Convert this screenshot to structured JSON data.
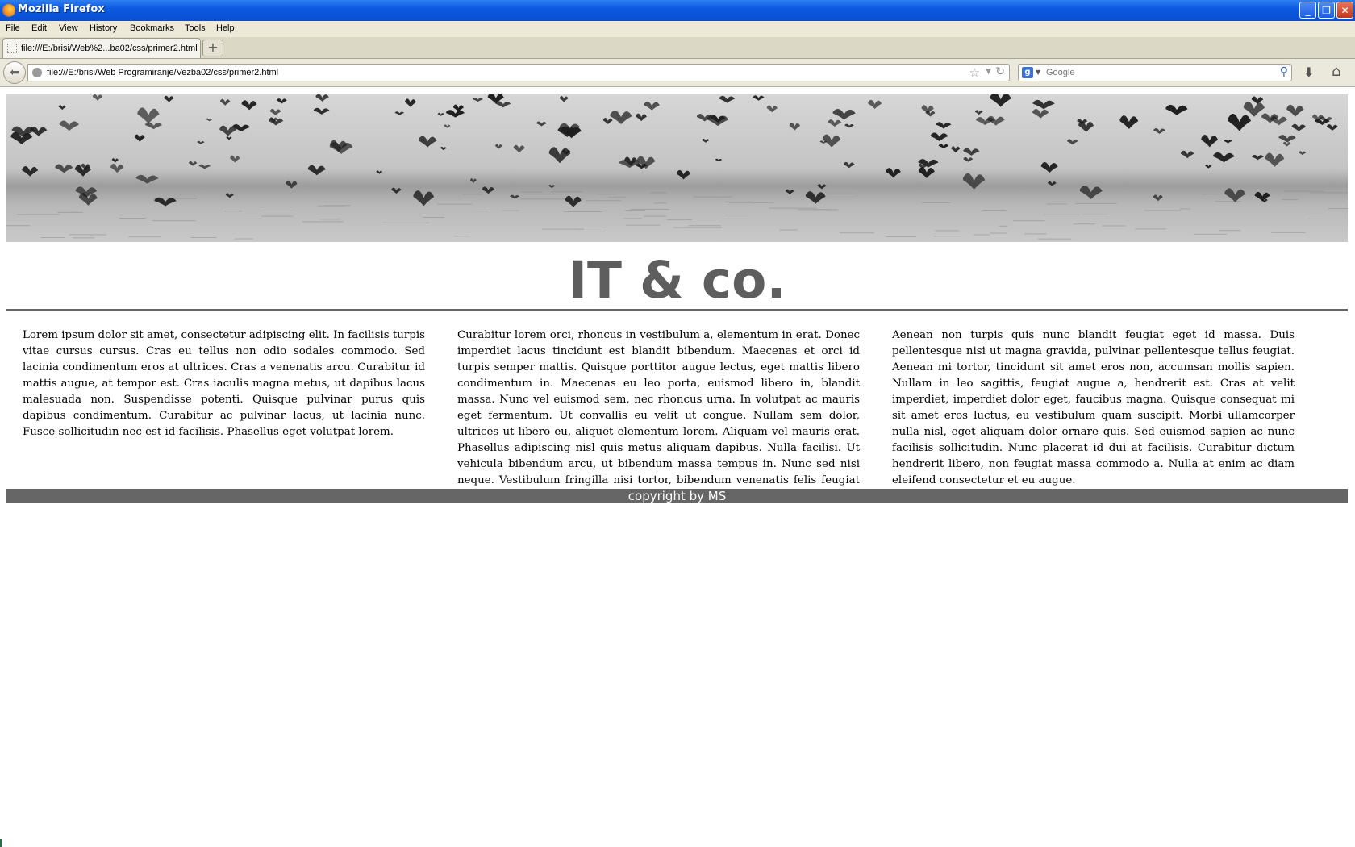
{
  "window": {
    "title": "Mozilla Firefox"
  },
  "menu": [
    "File",
    "Edit",
    "View",
    "History",
    "Bookmarks",
    "Tools",
    "Help"
  ],
  "tab": {
    "label": "file:///E:/brisi/Web%2...ba02/css/primer2.html",
    "new_tab": "+"
  },
  "nav": {
    "url": "file:///E:/brisi/Web Programiranje/Vezba02/css/primer2.html",
    "search_placeholder": "Google",
    "search_engine_letter": "g"
  },
  "page": {
    "title": "IT & co.",
    "columns": [
      "Lorem ipsum dolor sit amet, consectetur adipiscing elit. In facilisis turpis vitae cursus cursus. Cras eu tellus non odio sodales commodo. Sed lacinia condimentum eros at ultrices. Cras a venenatis arcu. Curabitur id mattis augue, at tempor est. Cras iaculis magna metus, ut dapibus lacus malesuada non. Suspendisse potenti. Quisque pulvinar purus quis dapibus condimentum. Curabitur ac pulvinar lacus, ut lacinia nunc. Fusce sollicitudin nec est id facilisis. Phasellus eget volutpat lorem.",
      "Curabitur lorem orci, rhoncus in vestibulum a, elementum in erat. Donec imperdiet lacus tincidunt est blandit bibendum. Maecenas et orci id turpis semper mattis. Quisque porttitor augue lectus, eget mattis libero condimentum in. Maecenas eu leo porta, euismod libero in, blandit massa. Nunc vel euismod sem, nec rhoncus urna. In volutpat ac mauris eget fermentum. Ut convallis eu velit ut congue. Nullam sem dolor, ultrices ut libero eu, aliquet elementum lorem. Aliquam vel mauris erat. Phasellus adipiscing nisl quis metus aliquam dapibus. Nulla facilisi. Ut vehicula bibendum arcu, ut bibendum massa tempus in. Nunc sed nisi neque. Vestibulum fringilla nisi tortor, bibendum venenatis felis feugiat at. In interdum luctus hendrerit.",
      "Aenean non turpis quis nunc blandit feugiat eget id massa. Duis pellentesque nisi ut magna gravida, pulvinar pellentesque tellus feugiat. Aenean mi tortor, tincidunt sit amet eros non, accumsan mollis sapien. Nullam in leo sagittis, feugiat augue a, hendrerit est. Cras at velit imperdiet, imperdiet dolor eget, faucibus magna. Quisque consequat mi sit amet eros luctus, eu vestibulum quam suscipit. Morbi ullamcorper nulla nisl, eget aliquam dolor ornare quis. Sed euismod sapien ac nunc facilisis sollicitudin. Nunc placerat id dui at facilisis. Curabitur dictum hendrerit libero, non feugiat massa commodo a. Nulla at enim ac diam eleifend consectetur et eu augue."
    ],
    "footer": "copyright by MS"
  },
  "colors": {
    "accent_gray": "#666666",
    "titlebar_blue": "#0b5ae0"
  }
}
